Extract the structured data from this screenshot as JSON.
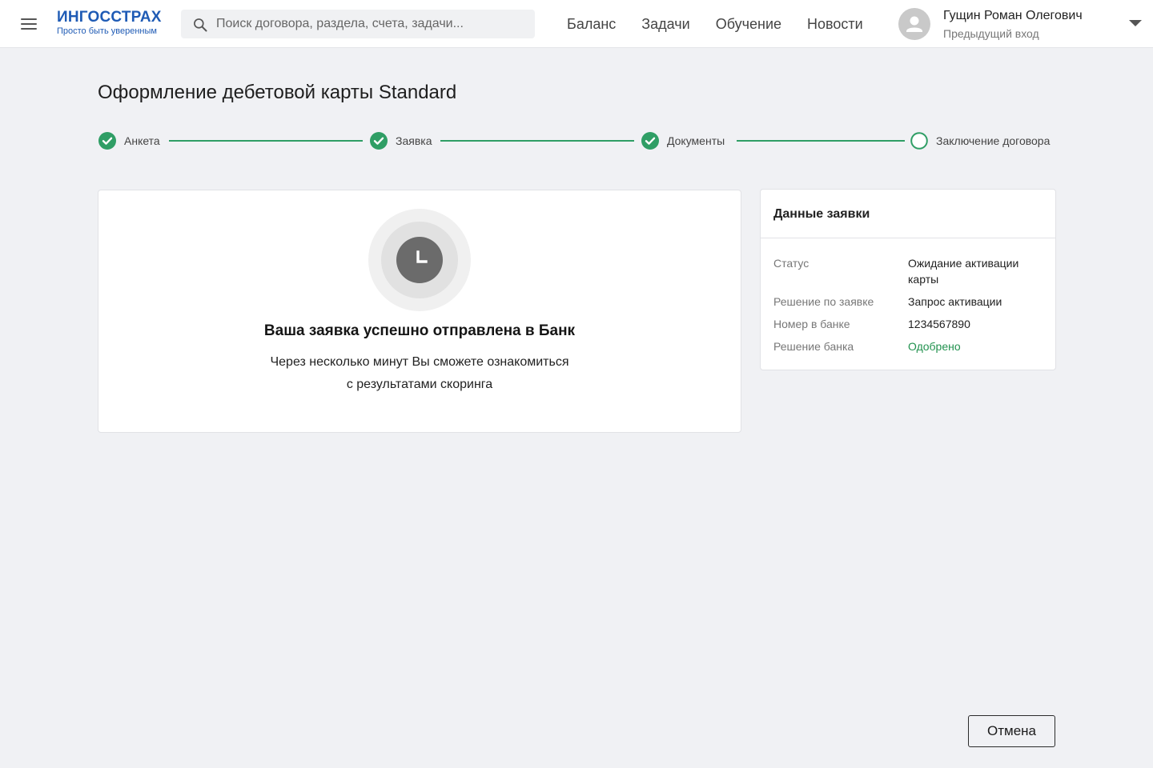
{
  "header": {
    "logo_title": "ИНГОССТРАХ",
    "logo_subtitle": "Просто быть уверенным",
    "search_placeholder": "Поиск договора, раздела, счета, задачи...",
    "nav": [
      {
        "label": "Баланс"
      },
      {
        "label": "Задачи"
      },
      {
        "label": "Обучение"
      },
      {
        "label": "Новости"
      }
    ],
    "user_name": "Гущин Роман Олегович",
    "user_sub": "Предыдущий вход"
  },
  "page": {
    "title": "Оформление дебетовой карты Standard"
  },
  "stepper": {
    "steps": [
      {
        "label": "Анкета",
        "state": "done"
      },
      {
        "label": "Заявка",
        "state": "done"
      },
      {
        "label": "Документы",
        "state": "done"
      },
      {
        "label": "Заключение договора",
        "state": "current"
      }
    ],
    "accent_color": "#2f9e65"
  },
  "status_card": {
    "icon": "clock-icon",
    "title": "Ваша заявка успешно отправлена в Банк",
    "text_line1": "Через несколько минут Вы сможете ознакомиться",
    "text_line2": "с результатами скоринга"
  },
  "details": {
    "title": "Данные заявки",
    "rows": [
      {
        "label": "Статус",
        "value": "Ожидание активации карты"
      },
      {
        "label": "Решение по заявке",
        "value": "Запрос активации"
      },
      {
        "label": "Номер в банке",
        "value": "1234567890"
      },
      {
        "label": "Решение банка",
        "value": "Одобрено"
      }
    ],
    "approved_color": "#22924f"
  },
  "actions": {
    "cancel_label": "Отмена"
  }
}
